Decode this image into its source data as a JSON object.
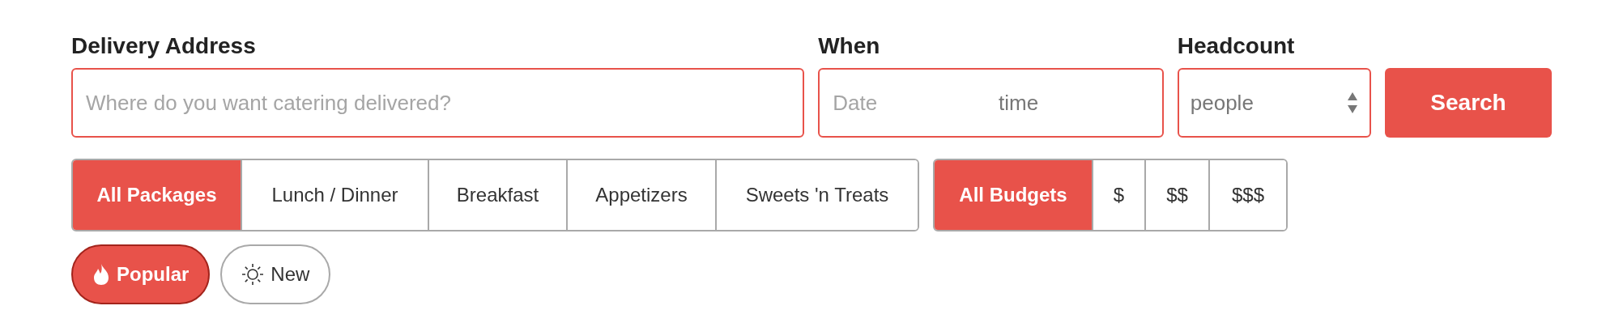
{
  "address": {
    "label": "Delivery Address",
    "placeholder": "Where do you want catering delivered?"
  },
  "when": {
    "label": "When",
    "date_placeholder": "Date",
    "time_value": "time"
  },
  "headcount": {
    "label": "Headcount",
    "value": "people"
  },
  "search_button": "Search",
  "package_tabs": [
    {
      "label": "All Packages",
      "selected": true
    },
    {
      "label": "Lunch / Dinner",
      "selected": false
    },
    {
      "label": "Breakfast",
      "selected": false
    },
    {
      "label": "Appetizers",
      "selected": false
    },
    {
      "label": "Sweets 'n Treats",
      "selected": false
    }
  ],
  "budget_tabs": [
    {
      "label": "All Budgets",
      "selected": true
    },
    {
      "label": "$",
      "selected": false
    },
    {
      "label": "$$",
      "selected": false
    },
    {
      "label": "$$$",
      "selected": false
    }
  ],
  "tags": [
    {
      "label": "Popular",
      "kind": "fire",
      "selected": true
    },
    {
      "label": "New",
      "kind": "sun",
      "selected": false
    }
  ]
}
